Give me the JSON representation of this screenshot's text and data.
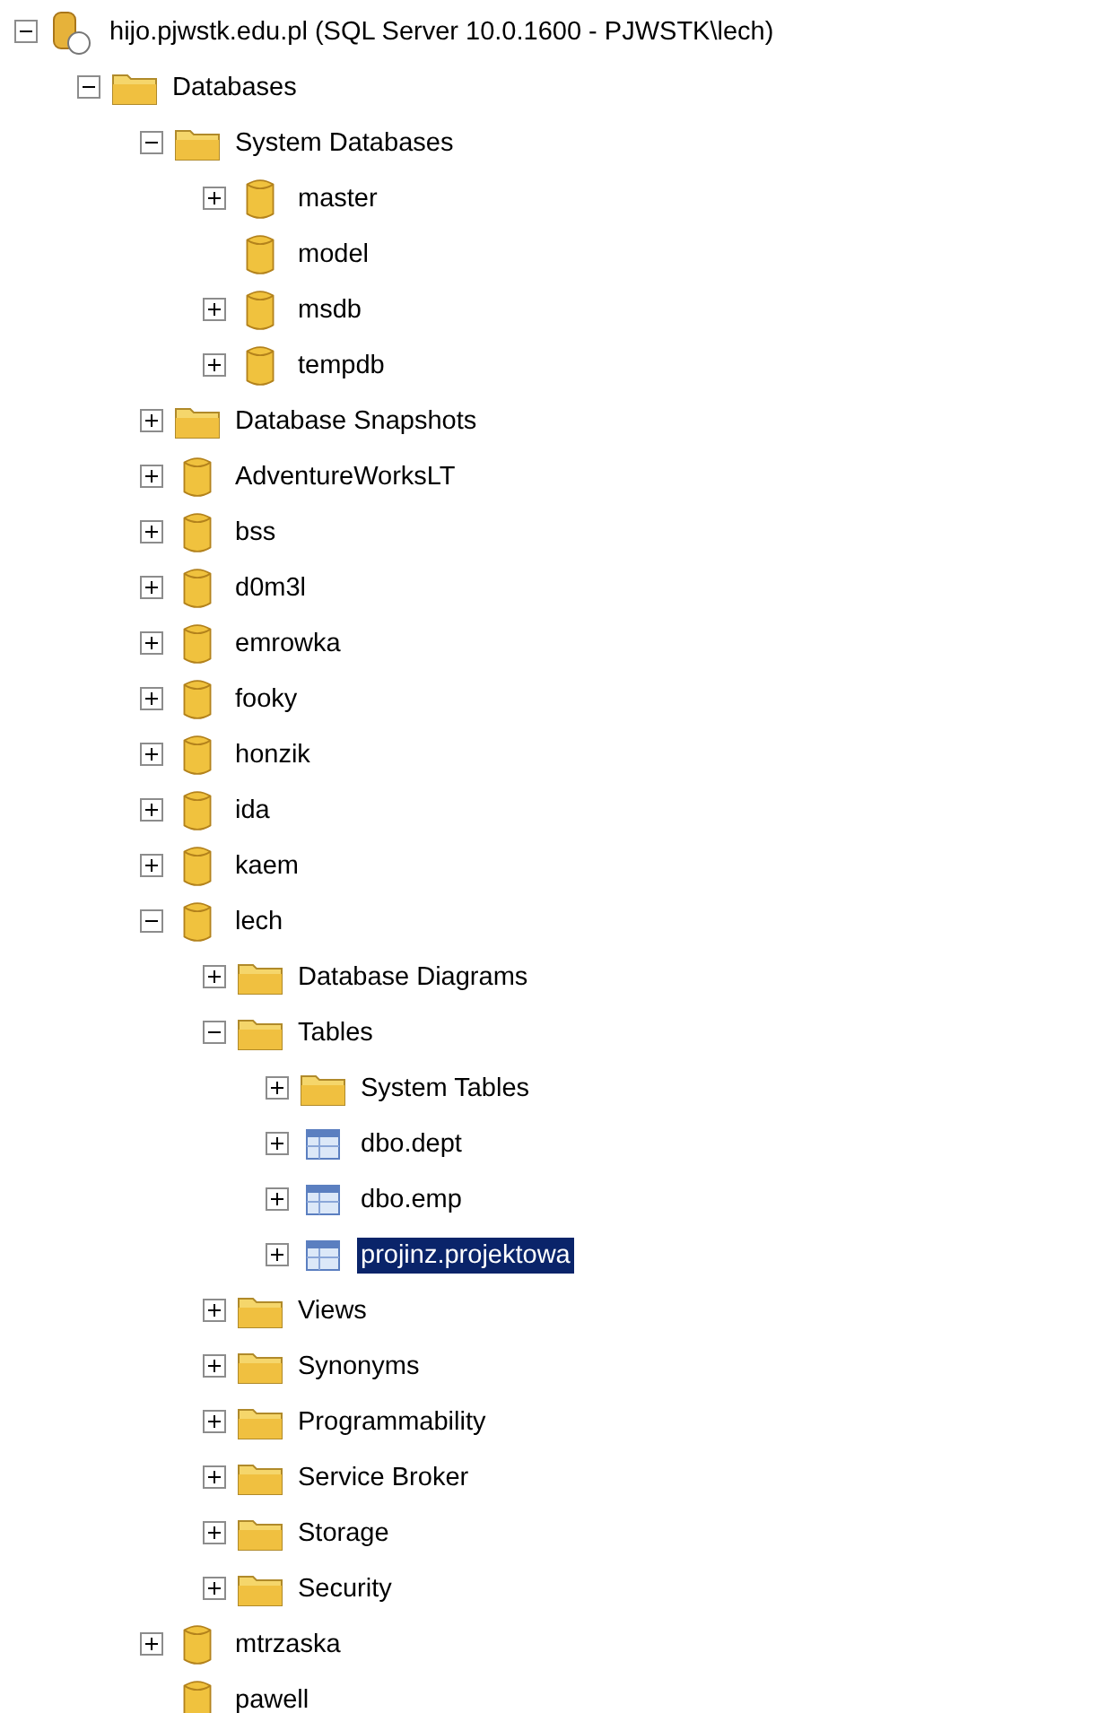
{
  "tree": [
    {
      "label": "hijo.pjwstk.edu.pl (SQL Server 10.0.1600 - PJWSTK\\lech)",
      "kind": "server",
      "expanded": true,
      "selected": false,
      "children": [
        {
          "label": "Databases",
          "kind": "folder",
          "expanded": true,
          "selected": false,
          "children": [
            {
              "label": "System Databases",
              "kind": "folder",
              "expanded": true,
              "selected": false,
              "children": [
                {
                  "label": "master",
                  "kind": "database",
                  "expanded": false,
                  "selected": false
                },
                {
                  "label": "model",
                  "kind": "database",
                  "selected": false
                },
                {
                  "label": "msdb",
                  "kind": "database",
                  "expanded": false,
                  "selected": false
                },
                {
                  "label": "tempdb",
                  "kind": "database",
                  "expanded": false,
                  "selected": false
                }
              ]
            },
            {
              "label": "Database Snapshots",
              "kind": "folder",
              "expanded": false,
              "selected": false
            },
            {
              "label": "AdventureWorksLT",
              "kind": "database",
              "expanded": false,
              "selected": false
            },
            {
              "label": "bss",
              "kind": "database",
              "expanded": false,
              "selected": false
            },
            {
              "label": "d0m3l",
              "kind": "database",
              "expanded": false,
              "selected": false
            },
            {
              "label": "emrowka",
              "kind": "database",
              "expanded": false,
              "selected": false
            },
            {
              "label": "fooky",
              "kind": "database",
              "expanded": false,
              "selected": false
            },
            {
              "label": "honzik",
              "kind": "database",
              "expanded": false,
              "selected": false
            },
            {
              "label": "ida",
              "kind": "database",
              "expanded": false,
              "selected": false
            },
            {
              "label": "kaem",
              "kind": "database",
              "expanded": false,
              "selected": false
            },
            {
              "label": "lech",
              "kind": "database",
              "expanded": true,
              "selected": false,
              "children": [
                {
                  "label": "Database Diagrams",
                  "kind": "folder",
                  "expanded": false,
                  "selected": false
                },
                {
                  "label": "Tables",
                  "kind": "folder",
                  "expanded": true,
                  "selected": false,
                  "children": [
                    {
                      "label": "System Tables",
                      "kind": "folder",
                      "expanded": false,
                      "selected": false
                    },
                    {
                      "label": "dbo.dept",
                      "kind": "table",
                      "expanded": false,
                      "selected": false
                    },
                    {
                      "label": "dbo.emp",
                      "kind": "table",
                      "expanded": false,
                      "selected": false
                    },
                    {
                      "label": "projinz.projektowa",
                      "kind": "table",
                      "expanded": false,
                      "selected": true
                    }
                  ]
                },
                {
                  "label": "Views",
                  "kind": "folder",
                  "expanded": false,
                  "selected": false
                },
                {
                  "label": "Synonyms",
                  "kind": "folder",
                  "expanded": false,
                  "selected": false
                },
                {
                  "label": "Programmability",
                  "kind": "folder",
                  "expanded": false,
                  "selected": false
                },
                {
                  "label": "Service Broker",
                  "kind": "folder",
                  "expanded": false,
                  "selected": false
                },
                {
                  "label": "Storage",
                  "kind": "folder",
                  "expanded": false,
                  "selected": false
                },
                {
                  "label": "Security",
                  "kind": "folder",
                  "expanded": false,
                  "selected": false
                }
              ]
            },
            {
              "label": "mtrzaska",
              "kind": "database",
              "expanded": false,
              "selected": false
            },
            {
              "label": "pawell",
              "kind": "database",
              "selected": false
            }
          ]
        }
      ]
    }
  ]
}
